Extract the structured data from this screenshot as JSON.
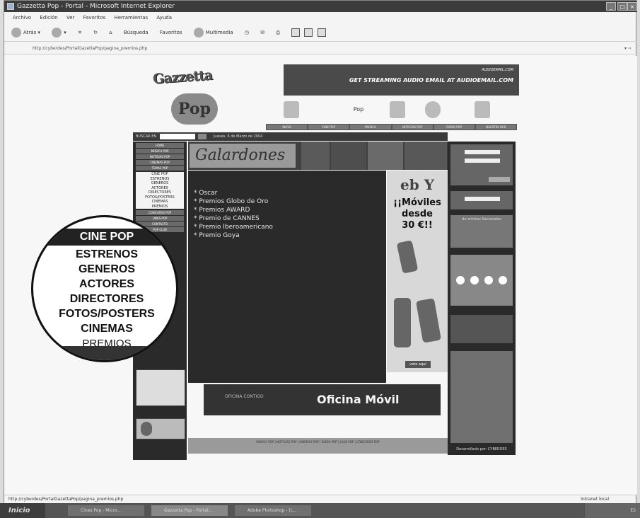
{
  "window": {
    "title": "Gazzetta Pop - Portal - Microsoft Internet Explorer"
  },
  "menu": [
    "Archivo",
    "Edición",
    "Ver",
    "Favoritos",
    "Herramientas",
    "Ayuda"
  ],
  "toolbar": {
    "back": "Atrás",
    "search": "Búsqueda",
    "favorites": "Favoritos",
    "multimedia": "Multimedia"
  },
  "address": {
    "url": "http://cyberdes/PortalGazettaPop/pagina_premios.php"
  },
  "page": {
    "logo_top": "Gazzetta",
    "logo_bottom": "Pop",
    "banner_small": "AUDIOEMAIL.COM",
    "banner_text": "GET STREAMING AUDIO EMAIL AT AUDIOEMAIL.COM",
    "thumb_pop": "Pop",
    "nav_tabs": [
      "INICIO",
      "CINE POP",
      "MUSICA",
      "NOTICIAS POP",
      "RADIO POP",
      "NUESTRA RED"
    ],
    "search_label": "BUSCAR EN",
    "date_text": "Jueves, 6 de Marzo de 2004",
    "left_top_items": [
      "HOME",
      "MÚSICA POP",
      "NOTICIAS POP",
      "CINEMAS POP",
      "TEMAS POP"
    ],
    "left_sub_items": [
      "CINE POP",
      "ESTRENOS",
      "GENEROS",
      "ACTORES",
      "DIRECTORES",
      "FOTOS/POSTERS",
      "CINEMAS",
      "PREMIOS"
    ],
    "left_bottom_items": [
      "CONCURSO POP",
      "LINKS POP",
      "CONTACTO",
      "POP CLUB"
    ],
    "section_title": "Galardones",
    "awards": [
      "* Oscar",
      "* Premios Globo de Oro",
      "* Premios AWARD",
      "* Premio de CANNES",
      "* Premio Iberoamericano",
      "* Premio Goya"
    ],
    "ad_brand": "eb Y",
    "ad_line1": "¡¡Móviles",
    "ad_line2": "desde",
    "ad_line3": "30 €!!",
    "ad_button": "vete aquí",
    "bottom_banner_small": "OFICINA CONTIGO",
    "bottom_banner_text": "Oficina Móvil",
    "footer_links": "MÚSICA POP | NOTICIAS POP | CINEMAS POP | RADIO POP | CLUB POP | CONCURSO POP",
    "right_artists": "de artistas Nacionales",
    "right_powered": "Desarrollado por: CYBERDES"
  },
  "magnifier": {
    "header": "CINE POP",
    "items": [
      "ESTRENOS",
      "GENEROS",
      "ACTORES",
      "DIRECTORES",
      "FOTOS/POSTERS",
      "CINEMAS",
      "PREMIOS"
    ]
  },
  "status": {
    "url": "http://cyberdes/PortalGazettaPop/pagina_premios.php",
    "zone": "Intranet local"
  },
  "taskbar": {
    "start": "Inicio",
    "tasks": [
      "Cines Pop - Micro...",
      "Gazzetta Pop - Portal...",
      "Adobe Photoshop - [c..."
    ],
    "tray": "ES"
  }
}
